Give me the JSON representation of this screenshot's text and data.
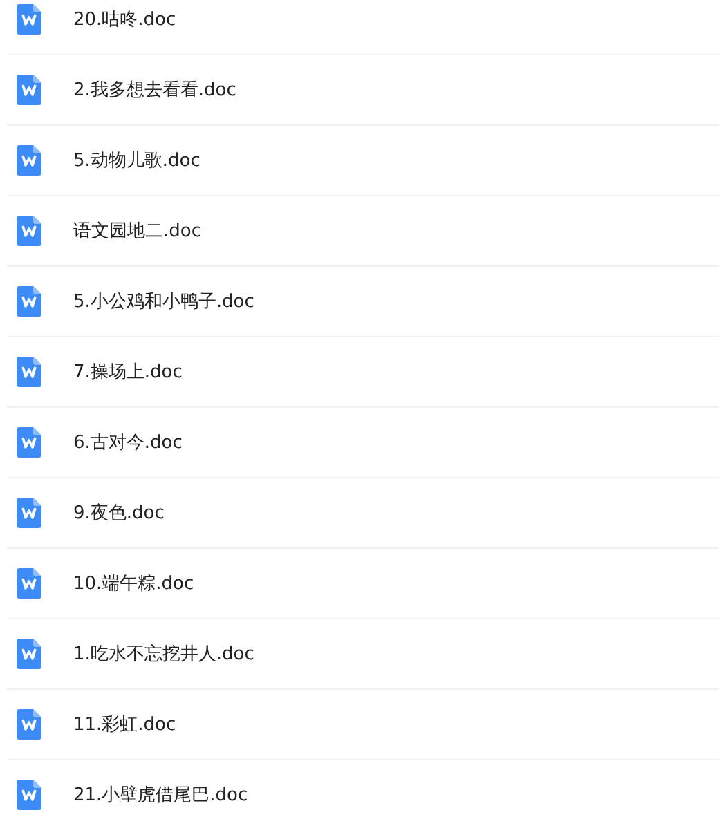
{
  "files": [
    {
      "name": "20.咕咚.doc"
    },
    {
      "name": "2.我多想去看看.doc"
    },
    {
      "name": "5.动物儿歌.doc"
    },
    {
      "name": "语文园地二.doc"
    },
    {
      "name": "5.小公鸡和小鸭子.doc"
    },
    {
      "name": "7.操场上.doc"
    },
    {
      "name": "6.古对今.doc"
    },
    {
      "name": "9.夜色.doc"
    },
    {
      "name": "10.端午粽.doc"
    },
    {
      "name": "1.吃水不忘挖井人.doc"
    },
    {
      "name": "11.彩虹.doc"
    },
    {
      "name": "21.小壁虎借尾巴.doc"
    }
  ]
}
